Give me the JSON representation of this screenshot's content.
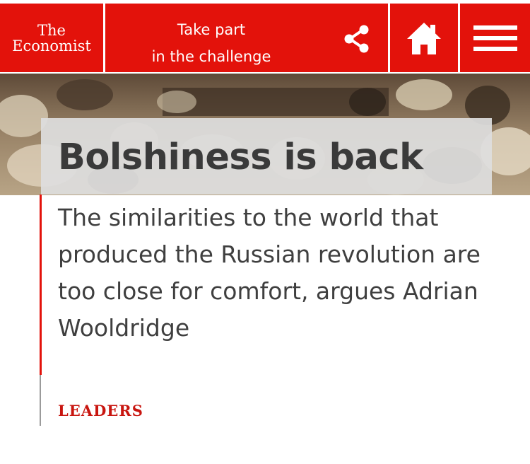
{
  "header": {
    "logo_line1": "The",
    "logo_line2": "Economist",
    "cta_line1": "Take part",
    "cta_line2": "in the challenge",
    "share_icon": "share-icon",
    "home_icon": "home-icon",
    "menu_icon": "hamburger-menu-icon"
  },
  "colors": {
    "brand_red": "#e3120b",
    "headline_gray": "#3a3a3a",
    "section_red": "#c8150f"
  },
  "article": {
    "headline": "Bolshiness is back",
    "standfirst": "The similarities to the world that produced the Russian revolution are too close for comfort, argues Adrian Wooldridge",
    "section": "LEADERS"
  }
}
